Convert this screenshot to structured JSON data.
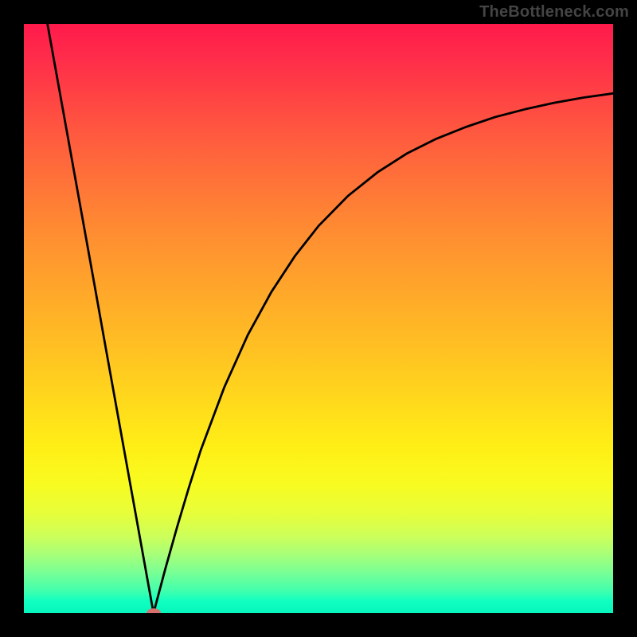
{
  "watermark": "TheBottleneck.com",
  "chart_data": {
    "type": "line",
    "title": "",
    "xlabel": "",
    "ylabel": "",
    "xlim": [
      0,
      100
    ],
    "ylim": [
      0,
      100
    ],
    "grid": false,
    "curve": {
      "name": "bottleneck-curve",
      "x_min_at": 22,
      "points": [
        {
          "x": 4.0,
          "y": 100.0
        },
        {
          "x": 6.0,
          "y": 88.9
        },
        {
          "x": 8.0,
          "y": 77.8
        },
        {
          "x": 10.0,
          "y": 66.7
        },
        {
          "x": 12.0,
          "y": 55.6
        },
        {
          "x": 14.0,
          "y": 44.4
        },
        {
          "x": 16.0,
          "y": 33.3
        },
        {
          "x": 18.0,
          "y": 22.2
        },
        {
          "x": 20.0,
          "y": 11.1
        },
        {
          "x": 22.0,
          "y": 0.0
        },
        {
          "x": 24.0,
          "y": 7.5
        },
        {
          "x": 26.0,
          "y": 14.6
        },
        {
          "x": 28.0,
          "y": 21.3
        },
        {
          "x": 30.0,
          "y": 27.6
        },
        {
          "x": 34.0,
          "y": 38.3
        },
        {
          "x": 38.0,
          "y": 47.2
        },
        {
          "x": 42.0,
          "y": 54.5
        },
        {
          "x": 46.0,
          "y": 60.6
        },
        {
          "x": 50.0,
          "y": 65.7
        },
        {
          "x": 55.0,
          "y": 70.8
        },
        {
          "x": 60.0,
          "y": 74.8
        },
        {
          "x": 65.0,
          "y": 78.0
        },
        {
          "x": 70.0,
          "y": 80.5
        },
        {
          "x": 75.0,
          "y": 82.5
        },
        {
          "x": 80.0,
          "y": 84.2
        },
        {
          "x": 85.0,
          "y": 85.5
        },
        {
          "x": 90.0,
          "y": 86.6
        },
        {
          "x": 95.0,
          "y": 87.5
        },
        {
          "x": 100.0,
          "y": 88.2
        }
      ]
    },
    "marker": {
      "x": 22,
      "y": 0,
      "color": "#d6716e"
    },
    "background_gradient": {
      "top": "#ff1a4b",
      "mid": "#ffef16",
      "bottom": "#06f5bd"
    }
  }
}
